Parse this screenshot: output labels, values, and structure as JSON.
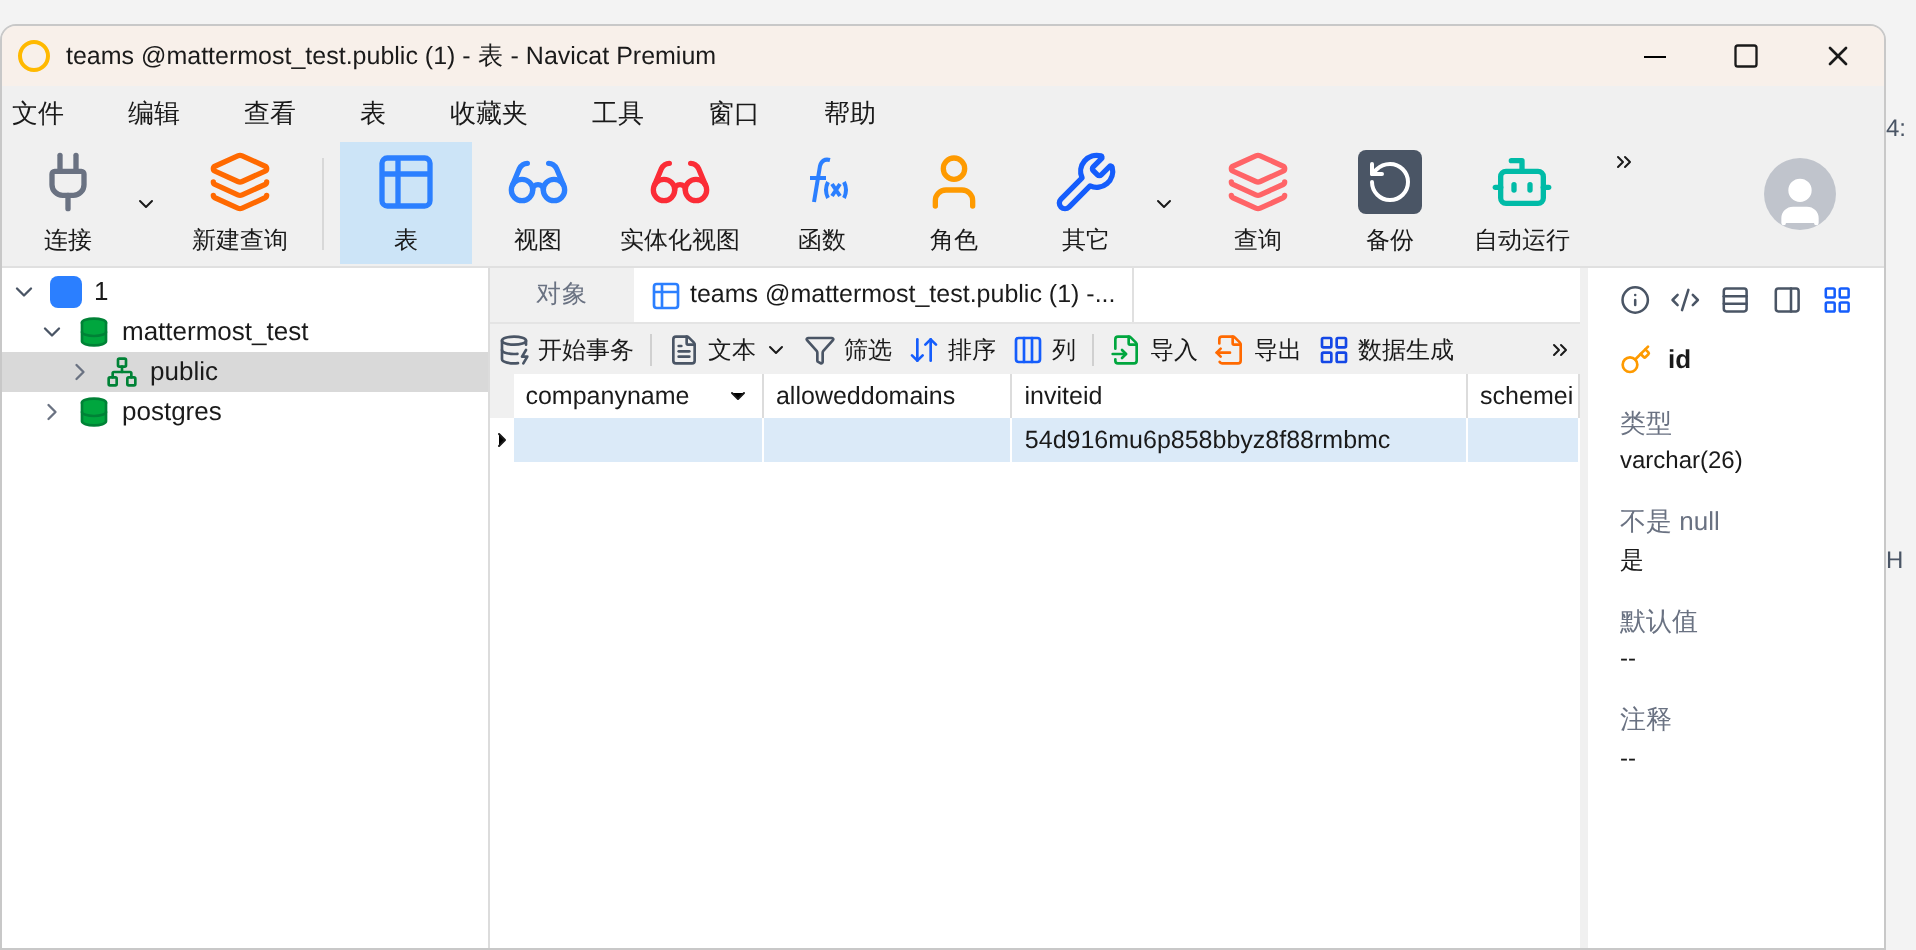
{
  "window": {
    "title": "teams @mattermost_test.public (1) - 表 - Navicat Premium"
  },
  "menu": [
    "文件",
    "编辑",
    "查看",
    "表",
    "收藏夹",
    "工具",
    "窗口",
    "帮助"
  ],
  "toolbar": [
    {
      "kind": "connect",
      "label": "连接",
      "dropdown": true,
      "selected": false
    },
    {
      "kind": "newquery",
      "label": "新建查询",
      "dropdown": false,
      "selected": false
    },
    {
      "kind": "table",
      "label": "表",
      "dropdown": false,
      "selected": true
    },
    {
      "kind": "view",
      "label": "视图",
      "dropdown": false,
      "selected": false
    },
    {
      "kind": "matview",
      "label": "实体化视图",
      "dropdown": false,
      "selected": false
    },
    {
      "kind": "function",
      "label": "函数",
      "dropdown": false,
      "selected": false
    },
    {
      "kind": "role",
      "label": "角色",
      "dropdown": false,
      "selected": false
    },
    {
      "kind": "other",
      "label": "其它",
      "dropdown": true,
      "selected": false
    },
    {
      "kind": "query",
      "label": "查询",
      "dropdown": false,
      "selected": false
    },
    {
      "kind": "backup",
      "label": "备份",
      "dropdown": false,
      "selected": false
    },
    {
      "kind": "robot",
      "label": "自动运行",
      "dropdown": false,
      "selected": false
    }
  ],
  "tree": [
    {
      "kind": "server",
      "label": "1",
      "expanded": true,
      "selected": false,
      "children": [
        {
          "kind": "database",
          "label": "mattermost_test",
          "expanded": true,
          "selected": false,
          "children": [
            {
              "kind": "schema",
              "label": "public",
              "expanded": false,
              "selected": true
            }
          ]
        },
        {
          "kind": "database",
          "label": "postgres",
          "expanded": false,
          "selected": false
        }
      ]
    }
  ],
  "tabs": [
    {
      "label": "对象",
      "kind": "plain",
      "selected": false
    },
    {
      "label": "teams @mattermost_test.public (1) -...",
      "kind": "table",
      "selected": true
    }
  ],
  "table_toolbar": [
    {
      "kind": "transaction",
      "label": "开始事务"
    },
    {
      "kind": "text",
      "label": "文本"
    },
    {
      "kind": "filter",
      "label": "筛选"
    },
    {
      "kind": "sort",
      "label": "排序"
    },
    {
      "kind": "columns",
      "label": "列"
    },
    {
      "kind": "import",
      "label": "导入"
    },
    {
      "kind": "export",
      "label": "导出"
    },
    {
      "kind": "generate",
      "label": "数据生成"
    }
  ],
  "table": {
    "columns": [
      "companyname",
      "alloweddomains",
      "inviteid",
      "schemei"
    ],
    "rows": [
      {
        "selected": true,
        "cells": [
          "",
          "",
          "54d916mu6p858bbyz8f88rmbmc",
          ""
        ]
      }
    ]
  },
  "field_panel": {
    "name": "id",
    "properties": [
      {
        "label": "类型",
        "value": "varchar(26)"
      },
      {
        "label": "不是 null",
        "value": "是"
      },
      {
        "label": "默认值",
        "value": "--"
      },
      {
        "label": "注释",
        "value": "--"
      }
    ]
  },
  "background_window": [
    "4:",
    "H"
  ]
}
